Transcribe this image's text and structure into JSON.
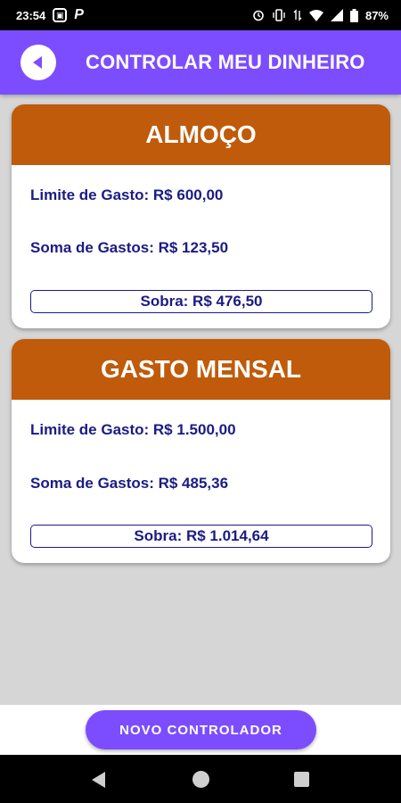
{
  "status_bar": {
    "time": "23:54",
    "battery": "87%"
  },
  "app_bar": {
    "title": "CONTROLAR MEU DINHEIRO",
    "back_icon": "back-arrow-icon",
    "color": "#7c4dff"
  },
  "cards": [
    {
      "title": "ALMOÇO",
      "limite": "Limite de Gasto: R$ 600,00",
      "soma": "Soma de Gastos: R$ 123,50",
      "sobra": "Sobra: R$ 476,50"
    },
    {
      "title": "GASTO MENSAL",
      "limite": "Limite de Gasto: R$ 1.500,00",
      "soma": "Soma de Gastos: R$ 485,36",
      "sobra": "Sobra: R$ 1.014,64"
    }
  ],
  "actions": {
    "novo_label": "NOVO CONTROLADOR"
  },
  "colors": {
    "accent": "#7c4dff",
    "card_header": "#bf5b0b",
    "text": "#1b1b85"
  }
}
